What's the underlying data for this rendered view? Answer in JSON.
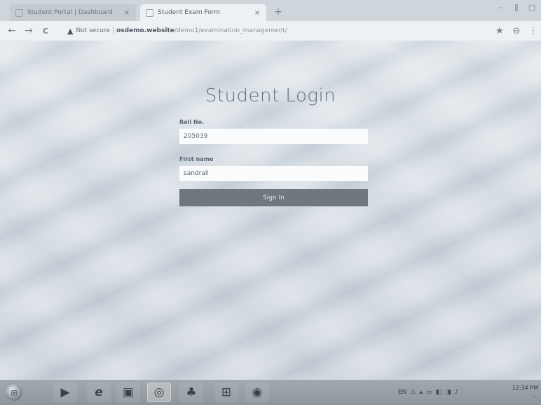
{
  "browser": {
    "tabs": [
      {
        "title": "Student Portal | Dashboard",
        "close": "×"
      },
      {
        "title": "Student Exam Form",
        "close": "×"
      }
    ],
    "new_tab": "+",
    "window_controls": [
      "–",
      "ǁ",
      "□"
    ],
    "nav": {
      "back": "←",
      "forward": "→",
      "reload": "C"
    },
    "address": {
      "security_icon": "▲",
      "security_text": "Not secure",
      "separator": "|",
      "host": "osdemo.website",
      "path": "/demo1/examination_management/"
    },
    "toolbar_icons": {
      "bookmark": "★",
      "account": "⊖",
      "menu": "⋮"
    }
  },
  "page": {
    "title": "Student Login",
    "form": {
      "roll_label": "Roll No.",
      "roll_value": "205039",
      "first_name_label": "First name",
      "first_name_value": "sandrali",
      "submit_label": "Sign In"
    }
  },
  "taskbar": {
    "start": "⊞",
    "apps": [
      "▶",
      "e",
      "▣",
      "◎",
      "♣",
      "⊞",
      "◉"
    ],
    "tray_icons": [
      "EN",
      "⚠",
      "▴",
      "▭",
      "◧",
      "◨",
      "♪"
    ],
    "clock": {
      "time": "12:34 PM",
      "date": "..."
    }
  },
  "colors": {
    "button_bg": "#6e787e",
    "input_bg": "#fafbfc",
    "title_color": "#66727d"
  }
}
